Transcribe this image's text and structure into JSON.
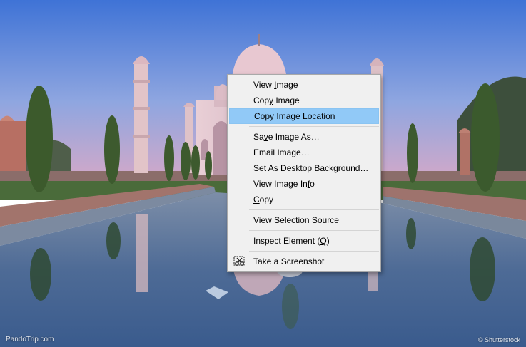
{
  "watermarks": {
    "left": "PandoTrip.com",
    "right": "© Shutterstock"
  },
  "context_menu": {
    "items": [
      {
        "type": "item",
        "pre": "View ",
        "key": "I",
        "post": "mage"
      },
      {
        "type": "item",
        "pre": "Cop",
        "key": "y",
        "post": " Image"
      },
      {
        "type": "item",
        "pre": "C",
        "key": "o",
        "post": "py Image Location",
        "highlighted": true
      },
      {
        "type": "separator"
      },
      {
        "type": "item",
        "pre": "Sa",
        "key": "v",
        "post": "e Image As…"
      },
      {
        "type": "item",
        "pre": "Email Ima",
        "key": "g",
        "post": "e…"
      },
      {
        "type": "item",
        "pre": "",
        "key": "S",
        "post": "et As Desktop Background…"
      },
      {
        "type": "item",
        "pre": "View Image In",
        "key": "f",
        "post": "o"
      },
      {
        "type": "item",
        "pre": "",
        "key": "C",
        "post": "opy"
      },
      {
        "type": "separator"
      },
      {
        "type": "item",
        "pre": "V",
        "key": "i",
        "post": "ew Selection Source"
      },
      {
        "type": "separator"
      },
      {
        "type": "item",
        "pre": "Inspect Element (",
        "key": "Q",
        "post": ")"
      },
      {
        "type": "separator"
      },
      {
        "type": "item",
        "pre": "Take a Screenshot",
        "key": "",
        "post": "",
        "icon": "screenshot-scissors-icon"
      }
    ]
  },
  "colors": {
    "menu_bg": "#f0f0f0",
    "menu_highlight": "#91c9f7",
    "sky_top": "#3f73d6",
    "sky_bottom": "#c3a3cf"
  }
}
